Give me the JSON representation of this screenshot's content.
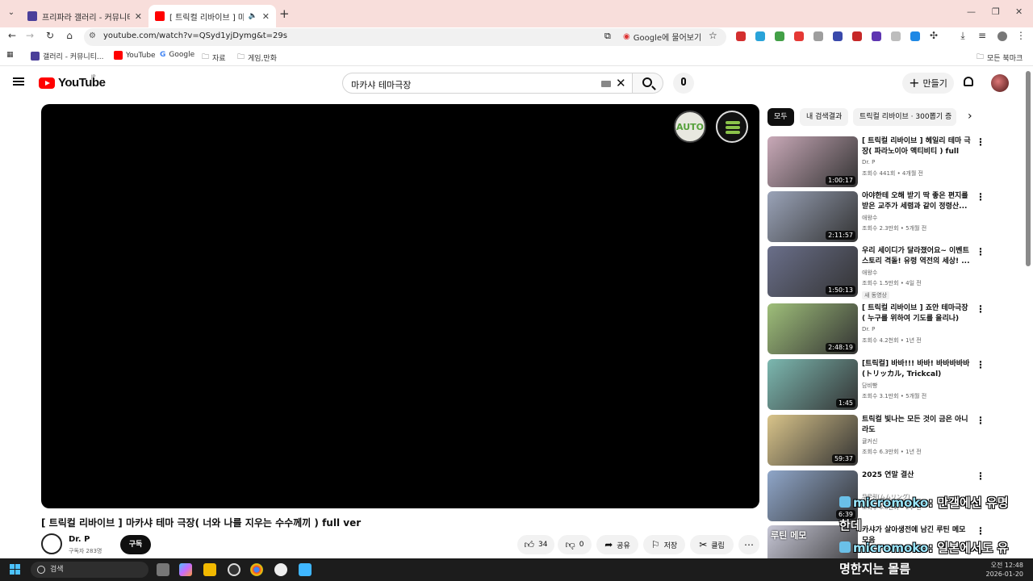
{
  "browser": {
    "tabs": [
      {
        "title": "프리파라 갤러리 - 커뮤니티 포",
        "active": false
      },
      {
        "title": "[ 트릭컬 리바이브 ] 마카샤",
        "active": true
      }
    ],
    "url": "youtube.com/watch?v=QSyd1yjDymg&t=29s",
    "lens_label": "Google에 물어보기",
    "bookmarks": [
      "갤러리 - 커뮤니티...",
      "YouTube",
      "Google",
      "자료",
      "게임,만화"
    ],
    "all_bookmarks": "모든 북마크"
  },
  "youtube": {
    "logo_text": "YouTube",
    "region": "JP",
    "search_value": "마카샤 테마극장",
    "create_label": "만들기"
  },
  "player": {
    "auto_label": "AUTO"
  },
  "video": {
    "title": "[ 트릭컬 리바이브 ] 마카샤 테마 극장( 너와 나를 지우는 수수께끼 ) full ver",
    "channel": "Dr. P",
    "subscribers": "구독자 283명",
    "subscribe_label": "구독",
    "likes": "34",
    "dislikes": "0",
    "share_label": "공유",
    "save_label": "저장",
    "clip_label": "클립"
  },
  "sidebar": {
    "chips": [
      "모두",
      "내 검색결과",
      "트릭컬 리바이브 · 300뽑기 증"
    ],
    "recommendations": [
      {
        "title": "[ 트릭컬 리바이브 ] 헤일리 테마 극장( 파라노이아 액티비티 ) full ver",
        "channel": "Dr. P",
        "meta": "조회수 441회 • 4개월 전",
        "duration": "1:00:17",
        "thumb_color": "#c9a9b8"
      },
      {
        "title": "아야한테 오해 받기 딱 좋은 편지를 받은 교주가 세렴과 같이 정령산...",
        "channel": "애왕수",
        "meta": "조회수 2.3만회 • 5개월 전",
        "duration": "2:11:57",
        "thumb_color": "#9aa3b8"
      },
      {
        "title": "우리 세이디가 달라졌어요~ 이벤트 스토리 격돌! 유령 역전의 세상! ...",
        "channel": "애왕수",
        "meta": "조회수 1.5만회 • 4일 전",
        "duration": "1:50:13",
        "badge": "새 동영상",
        "thumb_color": "#6a6f8a"
      },
      {
        "title": "[ 트릭컬 리바이브 ] 죠안 테마극장 ( 누구를 위하여 기도를 올리나) ful...",
        "channel": "Dr. P",
        "meta": "조회수 4.2천회 • 1년 전",
        "duration": "2:48:19",
        "thumb_color": "#9fbf7a"
      },
      {
        "title": "[트릭컬] 바바!!! 바바! 바바바바바 (トリッカル, Trickcal)",
        "channel": "담비빵",
        "meta": "조회수 3.1만회 • 5개월 전",
        "duration": "1:45",
        "thumb_color": "#7cb8b0"
      },
      {
        "title": "트릭컬 빛나는 모든 것이 금은 아니라도",
        "channel": "귤커신",
        "meta": "조회수 6.3만회 • 1년 전",
        "duration": "59:37",
        "thumb_color": "#d9c48a"
      },
      {
        "title": "2025 연말 결산",
        "channel": "무무링(ムムリング)",
        "meta": "조회수 6.6천회 • 2주 전",
        "duration": "6:39",
        "thumb_color": "#8fa6c9"
      },
      {
        "title": "카샤가 살아생전에 남긴 루틴 메모 모음",
        "channel": "",
        "meta": "",
        "duration": "",
        "thumb_overlay": "루틴 메모",
        "thumb_color": "#c7c7d6"
      }
    ]
  },
  "chat": [
    {
      "user": "micromoko",
      "text": ": 만갤에선 유명"
    },
    {
      "user": "",
      "text": "한데"
    },
    {
      "user": "micromoko",
      "text": ": 일본에서도 유"
    },
    {
      "user": "",
      "text": "명한지는 몰름"
    }
  ],
  "taskbar": {
    "search_label": "검색",
    "time": "오전 12:48",
    "date": "2026-01-20"
  }
}
